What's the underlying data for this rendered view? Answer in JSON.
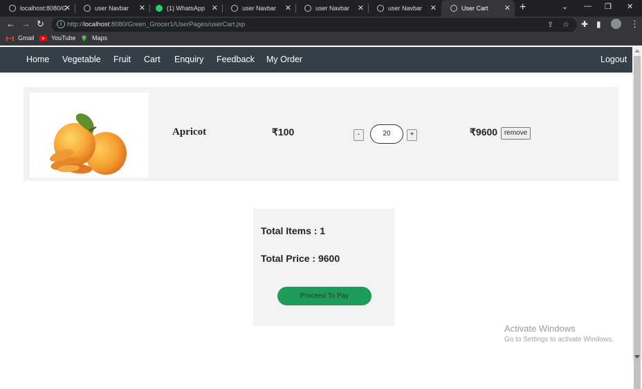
{
  "browser": {
    "tabs": [
      {
        "title": "localhost:8080/G",
        "icon": "globe-icon",
        "active": false
      },
      {
        "title": "user Navbar",
        "icon": "globe-icon",
        "active": false
      },
      {
        "title": "(1) WhatsApp",
        "icon": "whatsapp-icon",
        "active": false
      },
      {
        "title": "user Navbar",
        "icon": "globe-icon",
        "active": false
      },
      {
        "title": "user Navbar",
        "icon": "globe-icon",
        "active": false
      },
      {
        "title": "user Navbar",
        "icon": "globe-icon",
        "active": false
      },
      {
        "title": "User Cart",
        "icon": "globe-icon",
        "active": true
      }
    ],
    "url_prefix": "http://",
    "url_host": "localhost",
    "url_rest": ":8080/Green_Grocer1/UserPages/userCart.jsp",
    "bookmarks": [
      {
        "label": "Gmail",
        "icon": "gmail-icon"
      },
      {
        "label": "YouTube",
        "icon": "youtube-icon"
      },
      {
        "label": "Maps",
        "icon": "maps-icon"
      }
    ]
  },
  "navbar": {
    "links": [
      "Home",
      "Vegetable",
      "Fruit",
      "Cart",
      "Enquiry",
      "Feedback",
      "My Order"
    ],
    "logout": "Logout",
    "color": "#343f48"
  },
  "cart": {
    "item": {
      "name": "Apricot",
      "unit_price": "₹100",
      "quantity": "20",
      "decrement": "-",
      "increment": "+",
      "total": "₹9600",
      "remove_label": "remove"
    }
  },
  "summary": {
    "total_items": "Total Items : 1",
    "total_price": "Total Price : 9600",
    "pay_label": "Proceed To Pay",
    "pay_color": "#1d9d59"
  },
  "watermark": {
    "title": "Activate Windows",
    "subtitle": "Go to Settings to activate Windows."
  }
}
